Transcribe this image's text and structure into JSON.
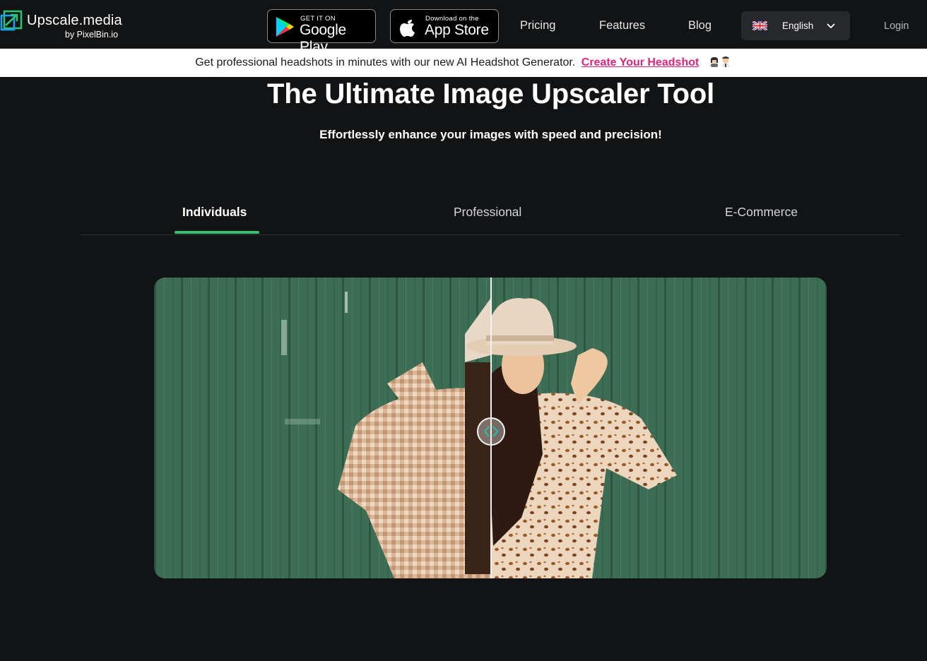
{
  "brand": {
    "name": "Upscale.media",
    "byline": "by PixelBin.io"
  },
  "nav": {
    "google_play": {
      "small": "GET IT ON",
      "big": "Google Play"
    },
    "app_store": {
      "small": "Download on the",
      "big": "App Store"
    },
    "links": [
      "Pricing",
      "Features",
      "Blog"
    ],
    "language": "English",
    "login": "Login"
  },
  "announcement": {
    "text": "Get professional headshots in minutes with our new AI Headshot Generator.",
    "link": "Create Your Headshot"
  },
  "hero": {
    "title": "The Ultimate Image Upscaler Tool",
    "subtitle": "Effortlessly enhance your images with speed and precision!"
  },
  "tabs": [
    {
      "label": "Individuals",
      "active": true
    },
    {
      "label": "Professional",
      "active": false
    },
    {
      "label": "E-Commerce",
      "active": false
    }
  ],
  "compare": {
    "split": 0.5
  },
  "colors": {
    "background": "#121314",
    "accent_green": "#2fc070",
    "link_pink": "#e0247a",
    "scene_green": "#3a6b52"
  }
}
